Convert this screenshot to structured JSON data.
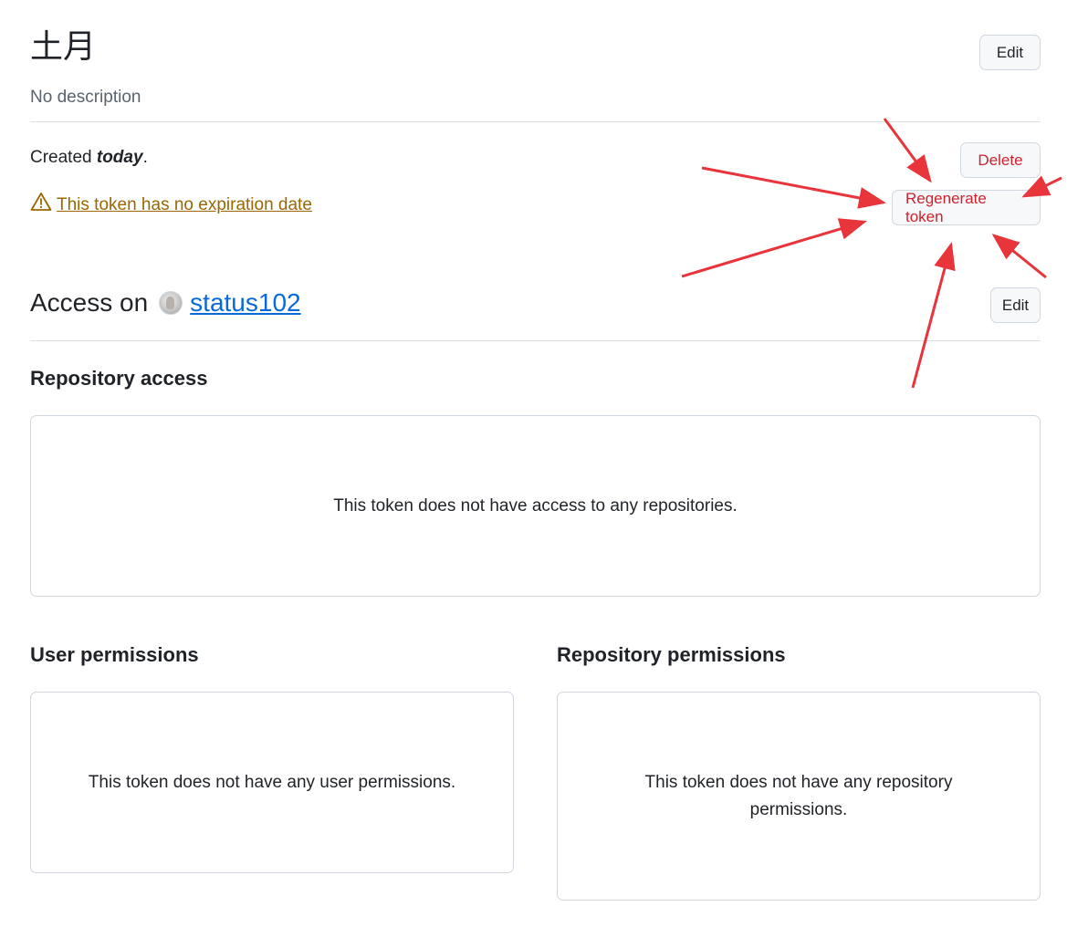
{
  "token": {
    "name": "土月",
    "description": "No description",
    "created_prefix": "Created ",
    "created_when": "today",
    "created_suffix": ".",
    "expiration_warning": "This token has no expiration date"
  },
  "buttons": {
    "edit_token": "Edit",
    "delete": "Delete",
    "regenerate": "Regenerate token",
    "edit_access": "Edit"
  },
  "access": {
    "prefix": "Access on",
    "owner": "status102"
  },
  "repository_access": {
    "heading": "Repository access",
    "empty_message": "This token does not have access to any repositories."
  },
  "user_permissions": {
    "heading": "User permissions",
    "empty_message": "This token does not have any user permissions."
  },
  "repository_permissions": {
    "heading": "Repository permissions",
    "empty_message_line1": "This token does not have any repository",
    "empty_message_line2": "permissions."
  },
  "colors": {
    "danger": "#cf222e",
    "attention": "#9a6700",
    "link": "#0969da",
    "annotation_arrow": "#e8343b"
  },
  "icons": {
    "warning": "alert-triangle-icon",
    "owner_avatar": "avatar"
  }
}
